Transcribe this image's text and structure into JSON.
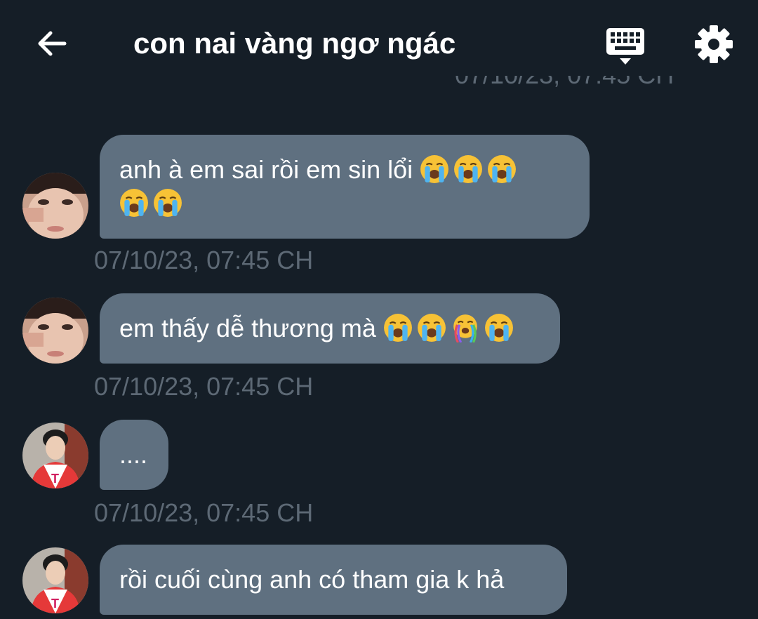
{
  "header": {
    "title": "con nai vàng ngơ ngác",
    "back_icon": "arrow-left-icon",
    "keyboard_icon": "keyboard-icon",
    "settings_icon": "gear-icon"
  },
  "messages": [
    {
      "sender": "contact",
      "text": "anh à em sai rồi em sin lổi",
      "emojis": [
        "loudly-crying-face",
        "loudly-crying-face",
        "loudly-crying-face",
        "loudly-crying-face",
        "loudly-crying-face"
      ],
      "timestamp": "07/10/23, 07:45 CH"
    },
    {
      "sender": "contact",
      "text": "em thấy dễ thương mà",
      "emojis": [
        "loudly-crying-face",
        "loudly-crying-face",
        "rainbow-crying-face",
        "loudly-crying-face"
      ],
      "timestamp": "07/10/23, 07:45 CH"
    },
    {
      "sender": "self",
      "text": "....",
      "emojis": [],
      "timestamp": "07/10/23, 07:45 CH"
    },
    {
      "sender": "self",
      "text": "rồi cuối cùng anh có tham gia k hả",
      "emojis": [],
      "timestamp": ""
    }
  ],
  "colors": {
    "background": "#151e27",
    "bubble": "#5f7080",
    "timestamp": "#5d6975",
    "text": "#ffffff"
  }
}
